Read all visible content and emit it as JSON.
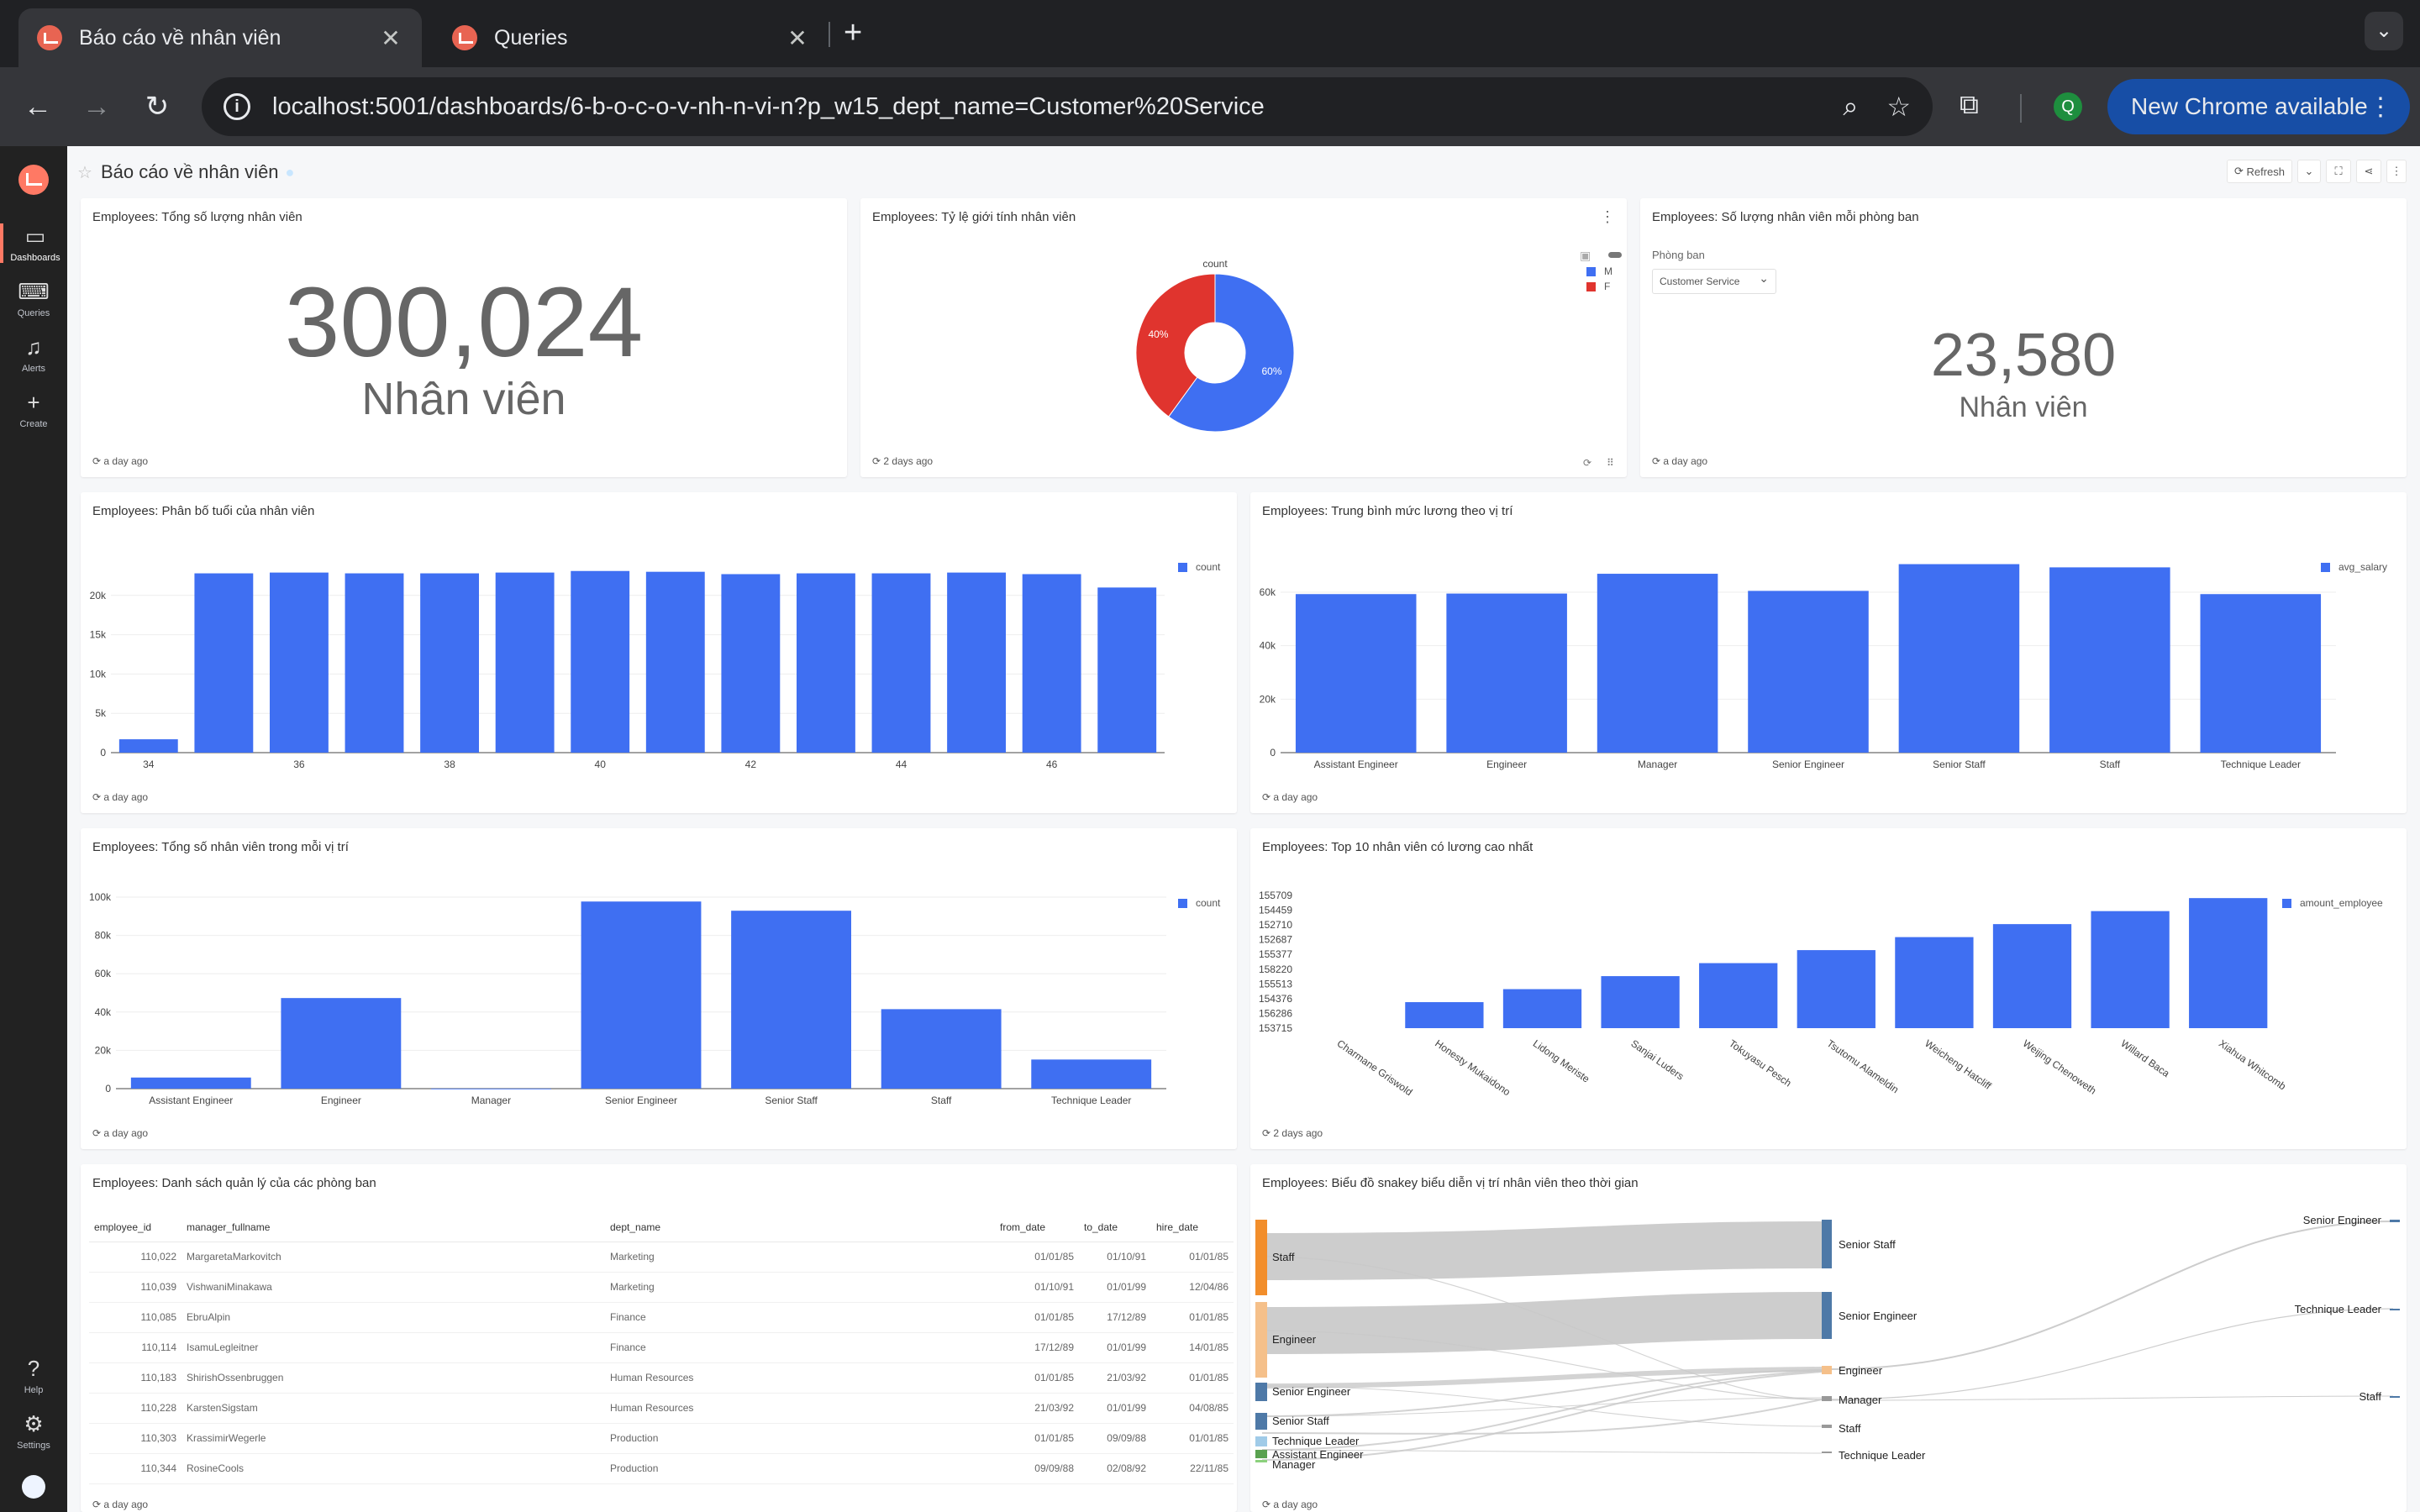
{
  "browser": {
    "tabs": [
      {
        "title": "Báo cáo về nhân viên",
        "close": "✕"
      },
      {
        "title": "Queries",
        "close": "✕"
      }
    ],
    "new_tab": "+",
    "url": "localhost:5001/dashboards/6-b-o-c-o-v-nh-n-vi-n?p_w15_dept_name=Customer%20Service",
    "profile_initial": "Q",
    "update_label": "New Chrome available"
  },
  "sidenav": {
    "items": [
      {
        "label": "Dashboards"
      },
      {
        "label": "Queries"
      },
      {
        "label": "Alerts"
      },
      {
        "label": "Create"
      },
      {
        "label": "Help"
      },
      {
        "label": "Settings"
      }
    ]
  },
  "dashboard": {
    "title": "Báo cáo về nhân viên",
    "refresh_label": "Refresh"
  },
  "widgets": {
    "total": {
      "title": "Employees: Tổng số lượng nhân viên",
      "value": "300,024",
      "unit": "Nhân viên",
      "updated": "a day ago"
    },
    "gender": {
      "title": "Employees: Tỷ lệ giới tính nhân viên",
      "updated": "2 days ago",
      "pie_label": "count",
      "legend": [
        "M",
        "F"
      ]
    },
    "dept": {
      "title": "Employees: Số lượng nhân viên mỗi phòng ban",
      "filter_label": "Phòng ban",
      "filter_value": "Customer Service",
      "value": "23,580",
      "unit": "Nhân viên",
      "updated": "a day ago"
    },
    "age": {
      "title": "Employees: Phân bố tuổi của nhân viên",
      "updated": "a day ago",
      "legend": "count"
    },
    "avg_salary": {
      "title": "Employees: Trung bình mức lương theo vị trí",
      "updated": "a day ago",
      "legend": "avg_salary"
    },
    "by_title": {
      "title": "Employees: Tổng số nhân viên trong mỗi vị trí",
      "updated": "a day ago",
      "legend": "count"
    },
    "top10": {
      "title": "Employees: Top 10 nhân viên có lương cao nhất",
      "updated": "2 days ago",
      "legend": "amount_employee"
    },
    "managers": {
      "title": "Employees: Danh sách quản lý của các phòng ban",
      "updated": "a day ago",
      "columns": [
        "employee_id",
        "manager_fullname",
        "dept_name",
        "from_date",
        "to_date",
        "hire_date"
      ],
      "rows": [
        [
          "110,022",
          "MargaretaMarkovitch",
          "Marketing",
          "01/01/85",
          "01/10/91",
          "01/01/85"
        ],
        [
          "110,039",
          "VishwaniMinakawa",
          "Marketing",
          "01/10/91",
          "01/01/99",
          "12/04/86"
        ],
        [
          "110,085",
          "EbruAlpin",
          "Finance",
          "01/01/85",
          "17/12/89",
          "01/01/85"
        ],
        [
          "110,114",
          "IsamuLegleitner",
          "Finance",
          "17/12/89",
          "01/01/99",
          "14/01/85"
        ],
        [
          "110,183",
          "ShirishOssenbruggen",
          "Human Resources",
          "01/01/85",
          "21/03/92",
          "01/01/85"
        ],
        [
          "110,228",
          "KarstenSigstam",
          "Human Resources",
          "21/03/92",
          "01/01/99",
          "04/08/85"
        ],
        [
          "110,303",
          "KrassimirWegerle",
          "Production",
          "01/01/85",
          "09/09/88",
          "01/01/85"
        ],
        [
          "110,344",
          "RosineCools",
          "Production",
          "09/09/88",
          "02/08/92",
          "22/11/85"
        ]
      ]
    },
    "sankey": {
      "title": "Employees: Biểu đồ snakey biểu diễn vị trí nhân viên theo thời gian",
      "updated": "a day ago",
      "col1": [
        "Staff",
        "Engineer",
        "Senior Engineer",
        "Senior Staff",
        "Technique Leader",
        "Assistant Engineer",
        "Manager"
      ],
      "col2": [
        "Senior Staff",
        "Senior Engineer",
        "Engineer",
        "Manager",
        "Staff",
        "Technique Leader"
      ],
      "col3": [
        "Senior Engineer",
        "Technique Leader",
        "Staff"
      ]
    }
  },
  "colors": {
    "bar": "#3f6ff2",
    "female": "#e0342e",
    "accent": "#ff7964"
  },
  "chart_data": [
    {
      "type": "pie",
      "title": "Employees: Tỷ lệ giới tính nhân viên",
      "categories": [
        "M",
        "F"
      ],
      "values": [
        60,
        40
      ],
      "labels": [
        "60%",
        "40%"
      ]
    },
    {
      "type": "bar",
      "title": "Employees: Phân bố tuổi của nhân viên",
      "categories": [
        34,
        35,
        36,
        37,
        38,
        39,
        40,
        41,
        42,
        43,
        44,
        45,
        46,
        47
      ],
      "xticks": [
        "34",
        "36",
        "38",
        "40",
        "42",
        "44",
        "46"
      ],
      "series": [
        {
          "name": "count",
          "values": [
            1700,
            22800,
            22900,
            22800,
            22800,
            22900,
            23100,
            23000,
            22700,
            22800,
            22800,
            22900,
            22700,
            21000
          ]
        }
      ],
      "ylim": [
        0,
        23500
      ],
      "yticks": [
        "0",
        "5k",
        "10k",
        "15k",
        "20k"
      ],
      "ytick_values": [
        0,
        5000,
        10000,
        15000,
        20000
      ]
    },
    {
      "type": "bar",
      "title": "Employees: Trung bình mức lương theo vị trí",
      "categories": [
        "Assistant Engineer",
        "Engineer",
        "Manager",
        "Senior Engineer",
        "Senior Staff",
        "Staff",
        "Technique Leader"
      ],
      "series": [
        {
          "name": "avg_salary",
          "values": [
            59300,
            59500,
            66900,
            60500,
            70500,
            69300,
            59300
          ]
        }
      ],
      "ylim": [
        0,
        71000
      ],
      "yticks": [
        "0",
        "20k",
        "40k",
        "60k"
      ],
      "ytick_values": [
        0,
        20000,
        40000,
        60000
      ]
    },
    {
      "type": "bar",
      "title": "Employees: Tổng số nhân viên trong mỗi vị trí",
      "categories": [
        "Assistant Engineer",
        "Engineer",
        "Manager",
        "Senior Engineer",
        "Senior Staff",
        "Staff",
        "Technique Leader"
      ],
      "series": [
        {
          "name": "count",
          "values": [
            5800,
            47300,
            24,
            97700,
            92900,
            41500,
            15200
          ]
        }
      ],
      "ylim": [
        0,
        100000
      ],
      "yticks": [
        "0",
        "20k",
        "40k",
        "60k",
        "80k",
        "100k"
      ],
      "ytick_values": [
        0,
        20000,
        40000,
        60000,
        80000,
        100000
      ]
    },
    {
      "type": "bar",
      "title": "Employees: Top 10 nhân viên có lương cao nhất",
      "categories": [
        "Charmane Griswold",
        "Honesty Mukaidono",
        "Lidong Meriste",
        "Sanjai Luders",
        "Tokuyasu Pesch",
        "Tsutomu Alameldin",
        "Weicheng Hatcliff",
        "Weijing Chenoweth",
        "Willard Baca",
        "Xiahua Whitcomb"
      ],
      "series": [
        {
          "name": "amount_employee",
          "values": [
            0,
            1,
            2,
            3,
            4,
            5,
            6,
            7,
            8,
            9
          ]
        }
      ],
      "yticks": [
        "155709",
        "154459",
        "152710",
        "152687",
        "155377",
        "158220",
        "155513",
        "154376",
        "156286",
        "153715"
      ]
    }
  ]
}
